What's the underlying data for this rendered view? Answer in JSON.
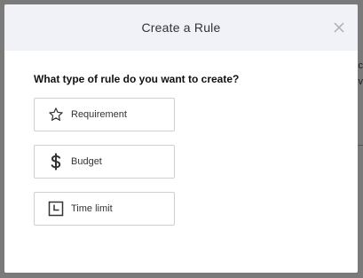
{
  "background": {
    "text_1": "c",
    "text_2": "v"
  },
  "modal": {
    "title": "Create a Rule",
    "close_icon": "close-icon",
    "question": "What type of rule do you want to create?",
    "options": [
      {
        "label": "Requirement",
        "icon": "star-icon"
      },
      {
        "label": "Budget",
        "icon": "dollar-icon"
      },
      {
        "label": "Time limit",
        "icon": "clock-icon"
      }
    ]
  },
  "colors": {
    "overlay": "#7a7a7a",
    "header_bg": "#f1f2f8",
    "border": "#cfcfcf"
  }
}
